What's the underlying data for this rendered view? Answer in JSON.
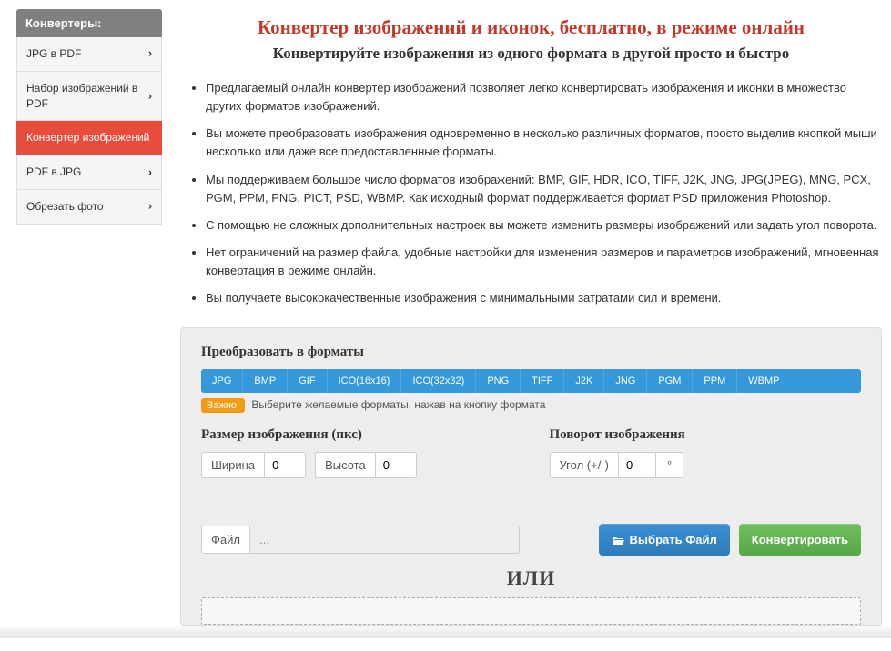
{
  "sidebar": {
    "header": "Конвертеры:",
    "items": [
      {
        "label": "JPG в PDF",
        "active": false
      },
      {
        "label": "Набор изображений в PDF",
        "active": false
      },
      {
        "label": "Конвертер изображений",
        "active": true
      },
      {
        "label": "PDF в JPG",
        "active": false
      },
      {
        "label": "Обрезать фото",
        "active": false
      }
    ]
  },
  "main": {
    "title": "Конвертер изображений и иконок, бесплатно, в режиме онлайн",
    "subtitle": "Конвертируйте изображения из одного формата в другой просто и быстро",
    "bullets": [
      "Предлагаемый онлайн конвертер изображений позволяет легко конвертировать изображения и иконки в множество других форматов изображений.",
      "Вы можете преобразовать изображения одновременно в несколько различных форматов, просто выделив кнопкой мыши несколько или даже все предоставленные форматы.",
      "Мы поддерживаем большое число форматов изображений: BMP, GIF, HDR, ICO, TIFF, J2K, JNG, JPG(JPEG), MNG, PCX, PGM, PPM, PNG, PICT, PSD, WBMP. Как исходный формат поддерживается формат PSD приложения Photoshop.",
      "С помощью не сложных дополнительных настроек вы можете изменить размеры изображений или задать угол поворота.",
      "Нет ограничений на размер файла, удобные настройки для изменения размеров и параметров изображений, мгновенная конвертация в режиме онлайн.",
      "Вы получаете высококачественные изображения с минимальными затратами сил и времени."
    ]
  },
  "panel": {
    "formats_title": "Преобразовать в форматы",
    "formats": [
      "JPG",
      "BMP",
      "GIF",
      "ICO(16x16)",
      "ICO(32x32)",
      "PNG",
      "TIFF",
      "J2K",
      "JNG",
      "PGM",
      "PPM",
      "WBMP"
    ],
    "hint_badge": "Важно!",
    "hint_text": "Выберите желаемые форматы, нажав на кнопку формата",
    "size_title": "Размер изображения (пкс)",
    "width_label": "Ширина",
    "width_value": "0",
    "height_label": "Высота",
    "height_value": "0",
    "rotate_title": "Поворот изображения",
    "angle_label": "Угол (+/-)",
    "angle_value": "0",
    "angle_unit": "°",
    "file_label": "Файл",
    "file_value": "...",
    "choose_btn": "Выбрать Файл",
    "convert_btn": "Конвертировать",
    "or": "ИЛИ"
  }
}
